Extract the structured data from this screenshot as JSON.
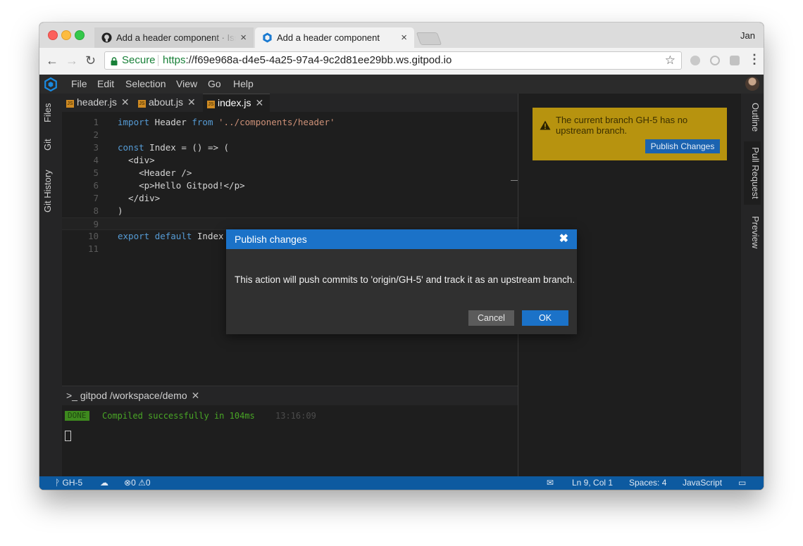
{
  "browser": {
    "tabs": [
      {
        "title": "Add a header component · Issue",
        "icon": "github-icon"
      },
      {
        "title": "Add a header component",
        "icon": "gitpod-icon"
      }
    ],
    "tab_close": "×",
    "profile": "Jan",
    "secure_label": "Secure",
    "url_scheme": "https",
    "url_rest": "://f69e968a-d4e5-4a25-97a4-9c2d81ee29bb.ws.gitpod.io"
  },
  "menu": [
    "File",
    "Edit",
    "Selection",
    "View",
    "Go",
    "Help"
  ],
  "left_tabs": [
    "Files",
    "Git",
    "Git History"
  ],
  "right_tabs": [
    "Outline",
    "Pull Request",
    "Preview"
  ],
  "editor_tabs": [
    "header.js",
    "about.js",
    "index.js"
  ],
  "active_editor_tab": "index.js",
  "code": {
    "line_numbers": [
      "1",
      "2",
      "3",
      "4",
      "5",
      "6",
      "7",
      "8",
      "9",
      "10",
      "11"
    ],
    "lines": [
      [
        [
          "kw",
          "import"
        ],
        [
          "p",
          " Header "
        ],
        [
          "kw",
          "from"
        ],
        [
          "p",
          " "
        ],
        [
          "str",
          "'../components/header'"
        ]
      ],
      [],
      [
        [
          "kw",
          "const"
        ],
        [
          "p",
          " Index = () => ("
        ]
      ],
      [
        [
          "p",
          "  <div>"
        ]
      ],
      [
        [
          "p",
          "    <Header />"
        ]
      ],
      [
        [
          "p",
          "    <p>Hello Gitpod!</p>"
        ]
      ],
      [
        [
          "p",
          "  </div>"
        ]
      ],
      [
        [
          "p",
          ")"
        ]
      ],
      [],
      [
        [
          "kw",
          "export"
        ],
        [
          "p",
          " "
        ],
        [
          "kw",
          "default"
        ],
        [
          "p",
          " Index"
        ]
      ],
      []
    ],
    "current_line": 9
  },
  "terminal": {
    "tab": ">_ gitpod /workspace/demo",
    "badge": "DONE",
    "message": "Compiled successfully in 104ms",
    "time": "13:16:09"
  },
  "notice": {
    "text": "The current branch GH-5 has no upstream branch.",
    "button": "Publish Changes"
  },
  "dialog": {
    "title": "Publish changes",
    "message": "This action will push commits to 'origin/GH-5' and track it as an upstream branch.",
    "cancel": "Cancel",
    "ok": "OK"
  },
  "status": {
    "branch": "GH-5",
    "errors": "0",
    "warnings": "0",
    "position": "Ln 9, Col 1",
    "spaces": "Spaces: 4",
    "language": "JavaScript"
  }
}
